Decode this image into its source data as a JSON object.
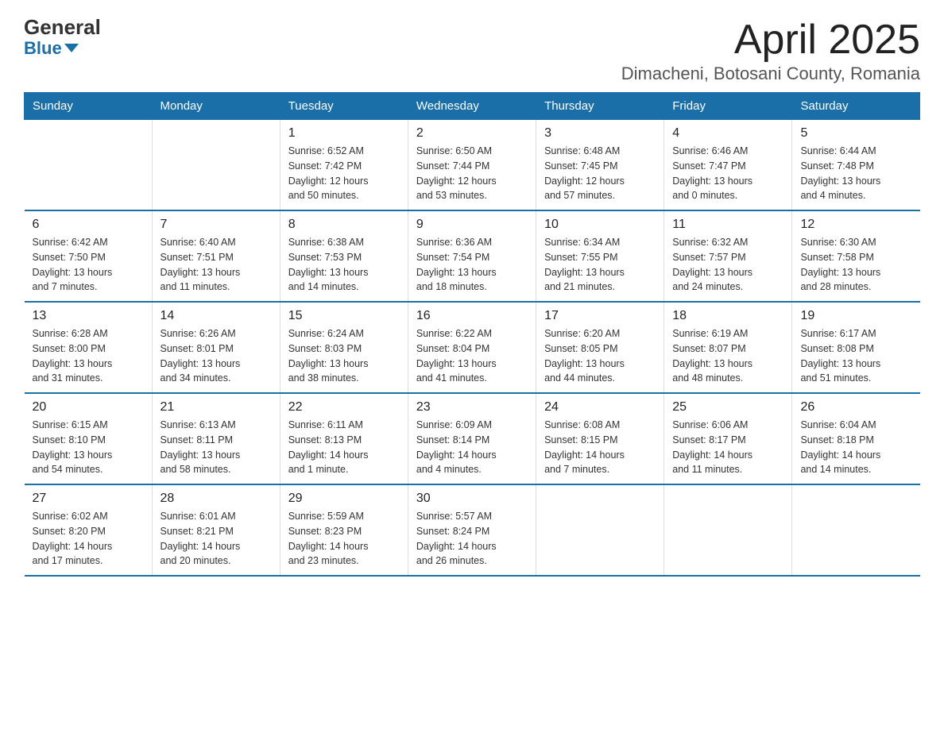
{
  "logo": {
    "line1": "General",
    "line2": "Blue"
  },
  "title": "April 2025",
  "subtitle": "Dimacheni, Botosani County, Romania",
  "weekdays": [
    "Sunday",
    "Monday",
    "Tuesday",
    "Wednesday",
    "Thursday",
    "Friday",
    "Saturday"
  ],
  "weeks": [
    [
      {
        "day": "",
        "info": ""
      },
      {
        "day": "",
        "info": ""
      },
      {
        "day": "1",
        "info": "Sunrise: 6:52 AM\nSunset: 7:42 PM\nDaylight: 12 hours\nand 50 minutes."
      },
      {
        "day": "2",
        "info": "Sunrise: 6:50 AM\nSunset: 7:44 PM\nDaylight: 12 hours\nand 53 minutes."
      },
      {
        "day": "3",
        "info": "Sunrise: 6:48 AM\nSunset: 7:45 PM\nDaylight: 12 hours\nand 57 minutes."
      },
      {
        "day": "4",
        "info": "Sunrise: 6:46 AM\nSunset: 7:47 PM\nDaylight: 13 hours\nand 0 minutes."
      },
      {
        "day": "5",
        "info": "Sunrise: 6:44 AM\nSunset: 7:48 PM\nDaylight: 13 hours\nand 4 minutes."
      }
    ],
    [
      {
        "day": "6",
        "info": "Sunrise: 6:42 AM\nSunset: 7:50 PM\nDaylight: 13 hours\nand 7 minutes."
      },
      {
        "day": "7",
        "info": "Sunrise: 6:40 AM\nSunset: 7:51 PM\nDaylight: 13 hours\nand 11 minutes."
      },
      {
        "day": "8",
        "info": "Sunrise: 6:38 AM\nSunset: 7:53 PM\nDaylight: 13 hours\nand 14 minutes."
      },
      {
        "day": "9",
        "info": "Sunrise: 6:36 AM\nSunset: 7:54 PM\nDaylight: 13 hours\nand 18 minutes."
      },
      {
        "day": "10",
        "info": "Sunrise: 6:34 AM\nSunset: 7:55 PM\nDaylight: 13 hours\nand 21 minutes."
      },
      {
        "day": "11",
        "info": "Sunrise: 6:32 AM\nSunset: 7:57 PM\nDaylight: 13 hours\nand 24 minutes."
      },
      {
        "day": "12",
        "info": "Sunrise: 6:30 AM\nSunset: 7:58 PM\nDaylight: 13 hours\nand 28 minutes."
      }
    ],
    [
      {
        "day": "13",
        "info": "Sunrise: 6:28 AM\nSunset: 8:00 PM\nDaylight: 13 hours\nand 31 minutes."
      },
      {
        "day": "14",
        "info": "Sunrise: 6:26 AM\nSunset: 8:01 PM\nDaylight: 13 hours\nand 34 minutes."
      },
      {
        "day": "15",
        "info": "Sunrise: 6:24 AM\nSunset: 8:03 PM\nDaylight: 13 hours\nand 38 minutes."
      },
      {
        "day": "16",
        "info": "Sunrise: 6:22 AM\nSunset: 8:04 PM\nDaylight: 13 hours\nand 41 minutes."
      },
      {
        "day": "17",
        "info": "Sunrise: 6:20 AM\nSunset: 8:05 PM\nDaylight: 13 hours\nand 44 minutes."
      },
      {
        "day": "18",
        "info": "Sunrise: 6:19 AM\nSunset: 8:07 PM\nDaylight: 13 hours\nand 48 minutes."
      },
      {
        "day": "19",
        "info": "Sunrise: 6:17 AM\nSunset: 8:08 PM\nDaylight: 13 hours\nand 51 minutes."
      }
    ],
    [
      {
        "day": "20",
        "info": "Sunrise: 6:15 AM\nSunset: 8:10 PM\nDaylight: 13 hours\nand 54 minutes."
      },
      {
        "day": "21",
        "info": "Sunrise: 6:13 AM\nSunset: 8:11 PM\nDaylight: 13 hours\nand 58 minutes."
      },
      {
        "day": "22",
        "info": "Sunrise: 6:11 AM\nSunset: 8:13 PM\nDaylight: 14 hours\nand 1 minute."
      },
      {
        "day": "23",
        "info": "Sunrise: 6:09 AM\nSunset: 8:14 PM\nDaylight: 14 hours\nand 4 minutes."
      },
      {
        "day": "24",
        "info": "Sunrise: 6:08 AM\nSunset: 8:15 PM\nDaylight: 14 hours\nand 7 minutes."
      },
      {
        "day": "25",
        "info": "Sunrise: 6:06 AM\nSunset: 8:17 PM\nDaylight: 14 hours\nand 11 minutes."
      },
      {
        "day": "26",
        "info": "Sunrise: 6:04 AM\nSunset: 8:18 PM\nDaylight: 14 hours\nand 14 minutes."
      }
    ],
    [
      {
        "day": "27",
        "info": "Sunrise: 6:02 AM\nSunset: 8:20 PM\nDaylight: 14 hours\nand 17 minutes."
      },
      {
        "day": "28",
        "info": "Sunrise: 6:01 AM\nSunset: 8:21 PM\nDaylight: 14 hours\nand 20 minutes."
      },
      {
        "day": "29",
        "info": "Sunrise: 5:59 AM\nSunset: 8:23 PM\nDaylight: 14 hours\nand 23 minutes."
      },
      {
        "day": "30",
        "info": "Sunrise: 5:57 AM\nSunset: 8:24 PM\nDaylight: 14 hours\nand 26 minutes."
      },
      {
        "day": "",
        "info": ""
      },
      {
        "day": "",
        "info": ""
      },
      {
        "day": "",
        "info": ""
      }
    ]
  ]
}
